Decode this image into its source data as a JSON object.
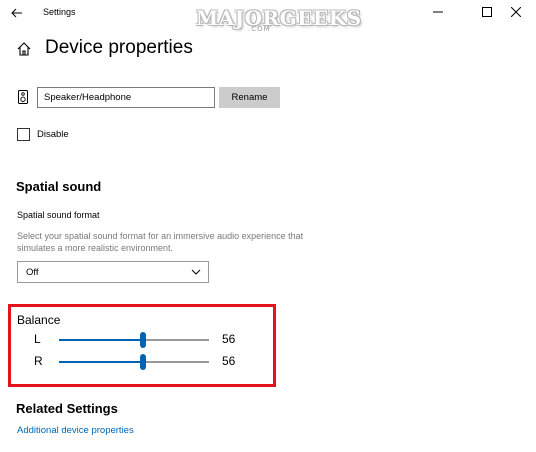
{
  "window": {
    "title": "Settings",
    "back_icon": "back-arrow-icon",
    "controls": [
      "minimize-icon",
      "maximize-icon",
      "close-icon"
    ]
  },
  "watermark": {
    "text": "MAJORGEEKS",
    "sub": ".COM"
  },
  "header": {
    "title": "Device properties",
    "icon": "home-icon"
  },
  "device": {
    "name_value": "Speaker/Headphone",
    "rename_label": "Rename",
    "icon": "speaker-device-icon"
  },
  "disable": {
    "label": "Disable",
    "checked": false
  },
  "spatial": {
    "heading": "Spatial sound",
    "format_label": "Spatial sound format",
    "description": "Select your spatial sound format for an immersive audio experience that simulates a more realistic environment.",
    "selected": "Off"
  },
  "balance": {
    "heading": "Balance",
    "channels": [
      {
        "label": "L",
        "value": 56
      },
      {
        "label": "R",
        "value": 56
      }
    ],
    "highlight_color": "#e3121c",
    "accent_color": "#0063b1"
  },
  "related": {
    "heading": "Related Settings",
    "link": "Additional device properties"
  }
}
